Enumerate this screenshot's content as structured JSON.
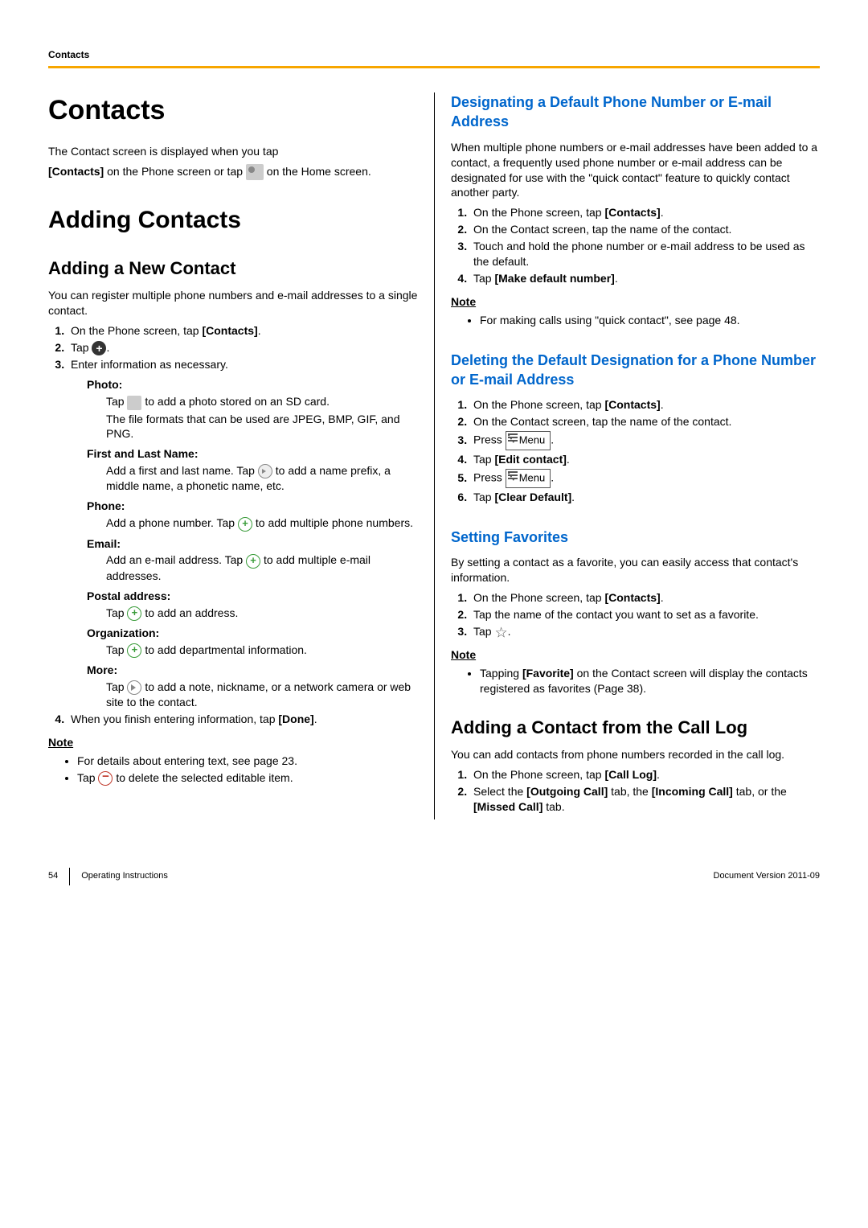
{
  "header": {
    "section": "Contacts"
  },
  "left": {
    "h1": "Contacts",
    "intro1": "The Contact screen is displayed when you tap",
    "intro2a": "[Contacts]",
    "intro2b": " on the Phone screen or tap ",
    "intro2c": " on the Home screen.",
    "h1b": "Adding Contacts",
    "h2a": "Adding a New Contact",
    "p1": "You can register multiple phone numbers and e-mail addresses to a single contact.",
    "ol1": {
      "i1a": "On the Phone screen, tap ",
      "i1b": "[Contacts]",
      "i1c": ".",
      "i2a": "Tap ",
      "i2b": ".",
      "i3": "Enter information as necessary."
    },
    "fields": {
      "photo_l": "Photo:",
      "photo1a": "Tap ",
      "photo1b": " to add a photo stored on an SD card.",
      "photo2": "The file formats that can be used are JPEG, BMP, GIF, and PNG.",
      "name_l": "First and Last Name:",
      "name1a": "Add a first and last name. Tap ",
      "name1b": " to add a name prefix, a middle name, a phonetic name, etc.",
      "phone_l": "Phone:",
      "phone1a": "Add a phone number. Tap ",
      "phone1b": " to add multiple phone numbers.",
      "email_l": "Email:",
      "email1a": "Add an e-mail address. Tap ",
      "email1b": " to add multiple e-mail addresses.",
      "postal_l": "Postal address:",
      "postal1a": "Tap ",
      "postal1b": " to add an address.",
      "org_l": "Organization:",
      "org1a": "Tap ",
      "org1b": " to add departmental information.",
      "more_l": "More:",
      "more1a": "Tap ",
      "more1b": " to add a note, nickname, or a network camera or web site to the contact."
    },
    "ol1_i4a": "When you finish entering information, tap ",
    "ol1_i4b": "[Done]",
    "ol1_i4c": ".",
    "note_l": "Note",
    "note1": "For details about entering text, see page 23.",
    "note2a": "Tap ",
    "note2b": " to delete the selected editable item."
  },
  "right": {
    "h3a": "Designating a Default Phone Number or E-mail Address",
    "p1": "When multiple phone numbers or e-mail addresses have been added to a contact, a frequently used phone number or e-mail address can be designated for use with the \"quick contact\" feature to quickly contact another party.",
    "olA": {
      "i1a": "On the Phone screen, tap ",
      "i1b": "[Contacts]",
      "i1c": ".",
      "i2": "On the Contact screen, tap the name of the contact.",
      "i3": "Touch and hold the phone number or e-mail address to be used as the default.",
      "i4a": "Tap ",
      "i4b": "[Make default number]",
      "i4c": "."
    },
    "noteA_l": "Note",
    "noteA1": "For making calls using \"quick contact\", see page 48.",
    "h3b": "Deleting the Default Designation for a Phone Number or E-mail Address",
    "olB": {
      "i1a": "On the Phone screen, tap ",
      "i1b": "[Contacts]",
      "i1c": ".",
      "i2": "On the Contact screen, tap the name of the contact.",
      "i3a": "Press ",
      "i3b": ".",
      "i4a": "Tap ",
      "i4b": "[Edit contact]",
      "i4c": ".",
      "i5a": "Press ",
      "i5b": ".",
      "i6a": "Tap ",
      "i6b": "[Clear Default]",
      "i6c": "."
    },
    "menu_label": "Menu",
    "h3c": "Setting Favorites",
    "p2": "By setting a contact as a favorite, you can easily access that contact's information.",
    "olC": {
      "i1a": "On the Phone screen, tap ",
      "i1b": "[Contacts]",
      "i1c": ".",
      "i2": "Tap the name of the contact you want to set as a favorite.",
      "i3a": "Tap ",
      "i3b": "."
    },
    "noteC_l": "Note",
    "noteC1a": "Tapping ",
    "noteC1b": "[Favorite]",
    "noteC1c": " on the Contact screen will display the contacts registered as favorites (Page 38).",
    "h2b": "Adding a Contact from the Call Log",
    "p3": "You can add contacts from phone numbers recorded in the call log.",
    "olD": {
      "i1a": "On the Phone screen, tap ",
      "i1b": "[Call Log]",
      "i1c": ".",
      "i2a": "Select the ",
      "i2b": "[Outgoing Call]",
      "i2c": " tab, the ",
      "i2d": "[Incoming Call]",
      "i2e": " tab, or the ",
      "i2f": "[Missed Call]",
      "i2g": " tab."
    }
  },
  "footer": {
    "page": "54",
    "title": "Operating Instructions",
    "version": "Document Version   2011-09"
  }
}
